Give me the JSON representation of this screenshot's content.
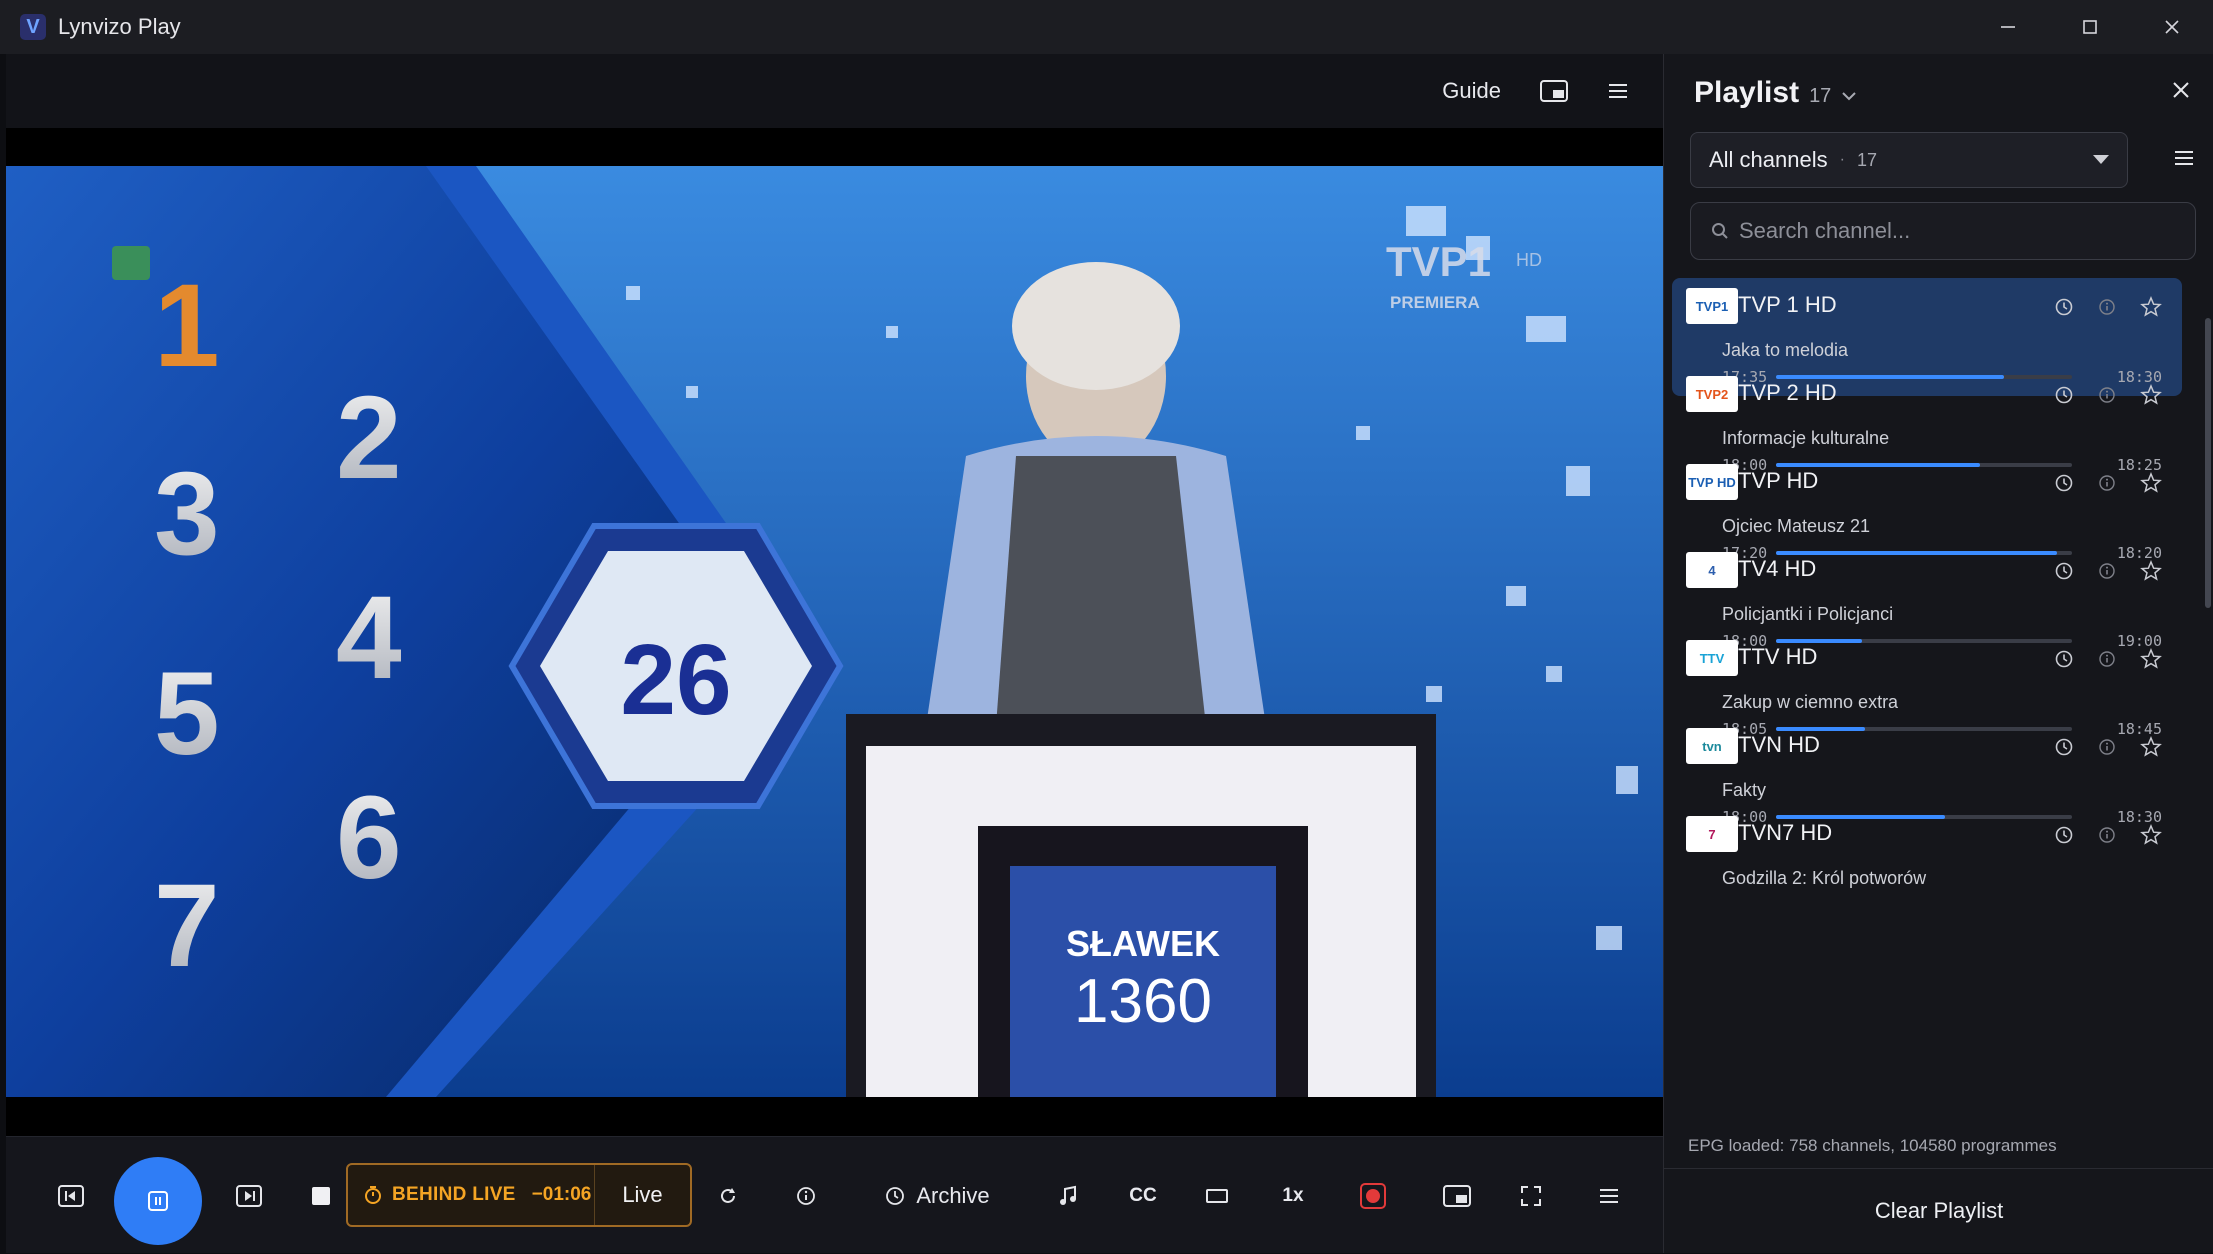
{
  "window": {
    "title": "Lynvizo Play",
    "logo_letter": "V",
    "controls": [
      "minimize-icon",
      "maximize-icon",
      "close-icon"
    ]
  },
  "player_top": {
    "guide_label": "Guide",
    "icons": [
      "picture-in-picture-icon",
      "menu-icon"
    ]
  },
  "video": {
    "channel_watermark": "TVP1",
    "watermark_sub": "PREMIERA",
    "hd_badge": "HD",
    "board_numbers": [
      "1",
      "2",
      "3",
      "4",
      "5",
      "6",
      "7"
    ],
    "hex_number": "26",
    "podium_name": "SŁAWEK",
    "podium_score": "1360"
  },
  "controls": {
    "behind_live_label": "BEHIND LIVE",
    "behind_time": "−01:06",
    "live_label": "Live",
    "archive_label": "Archive",
    "cc_label": "CC",
    "speed_label": "1x",
    "record_color": "#e23a3a"
  },
  "sidebar": {
    "title": "Playlist",
    "count": "17",
    "filter": {
      "label": "All channels",
      "separator": "·",
      "count": "17"
    },
    "search_placeholder": "Search channel...",
    "channels": [
      {
        "name": "TVP 1 HD",
        "program": "Jaka to melodia",
        "start": "17:35",
        "end": "18:30",
        "progress": 0.77,
        "logo": "TVP1",
        "logo_bg": "#ffffff",
        "logo_fg": "#1b5fb3",
        "active": true
      },
      {
        "name": "TVP 2 HD",
        "program": "Informacje kulturalne",
        "start": "18:00",
        "end": "18:25",
        "progress": 0.69,
        "logo": "TVP2",
        "logo_bg": "#ffffff",
        "logo_fg": "#e4541b",
        "active": false
      },
      {
        "name": "TVP HD",
        "program": "Ojciec Mateusz 21",
        "start": "17:20",
        "end": "18:20",
        "progress": 0.95,
        "logo": "TVP HD",
        "logo_bg": "#ffffff",
        "logo_fg": "#1b5fb3",
        "active": false
      },
      {
        "name": "TV4 HD",
        "program": "Policjantki i Policjanci",
        "start": "18:00",
        "end": "19:00",
        "progress": 0.29,
        "logo": "4",
        "logo_bg": "#ffffff",
        "logo_fg": "#2d5fae",
        "active": false
      },
      {
        "name": "TTV HD",
        "program": "Zakup w ciemno extra",
        "start": "18:05",
        "end": "18:45",
        "progress": 0.3,
        "logo": "TTV",
        "logo_bg": "#ffffff",
        "logo_fg": "#1aa3d6",
        "active": false
      },
      {
        "name": "TVN HD",
        "program": "Fakty",
        "start": "18:00",
        "end": "18:30",
        "progress": 0.57,
        "logo": "tvn",
        "logo_bg": "#ffffff",
        "logo_fg": "#1c8a9c",
        "active": false
      },
      {
        "name": "TVN7 HD",
        "program": "Godzilla 2: Król potworów",
        "start": "",
        "end": "",
        "progress": 0,
        "logo": "7",
        "logo_bg": "#ffffff",
        "logo_fg": "#b2185b",
        "active": false
      }
    ],
    "epg_status": "EPG loaded: 758 channels, 104580 programmes",
    "clear_label": "Clear Playlist"
  },
  "colors": {
    "accent": "#2f7df6",
    "warning": "#f5a524",
    "active_row": "#1f3a66"
  }
}
